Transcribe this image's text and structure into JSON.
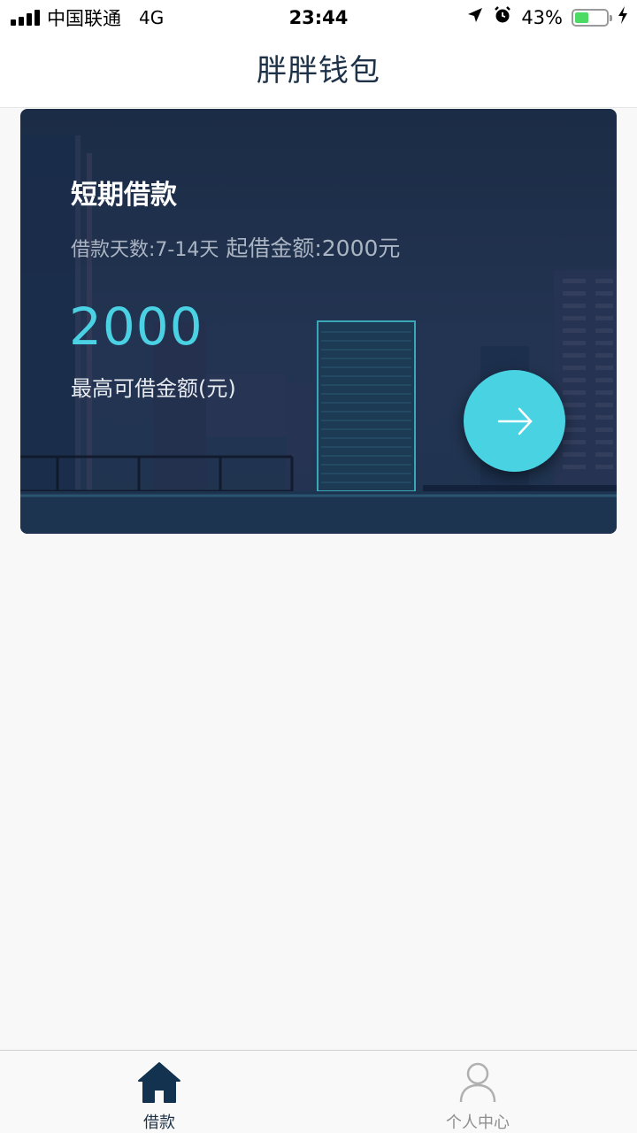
{
  "status_bar": {
    "carrier": "中国联通",
    "network": "4G",
    "time": "23:44",
    "battery": "43%",
    "battery_level": 0.43
  },
  "header": {
    "title": "胖胖钱包"
  },
  "loan_card": {
    "title": "短期借款",
    "terms_days": "借款天数:7-14天",
    "terms_min": "起借金额:2000元",
    "amount": "2000",
    "amount_label": "最高可借金额(元)"
  },
  "tab_bar": {
    "items": [
      {
        "label": "借款",
        "icon": "home-icon",
        "active": true
      },
      {
        "label": "个人中心",
        "icon": "user-icon",
        "active": false
      }
    ]
  },
  "colors": {
    "accent": "#49d2e2",
    "header_text": "#1d3147",
    "card_bg": "#1f3050"
  }
}
